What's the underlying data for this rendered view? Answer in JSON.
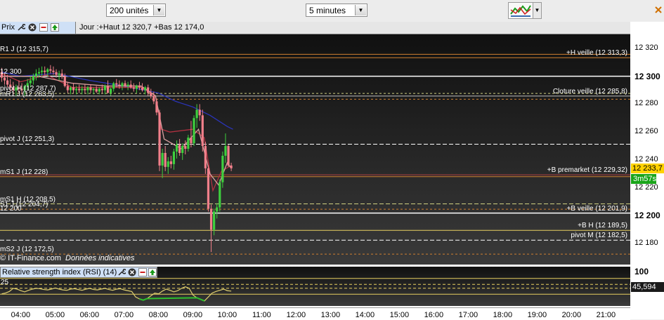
{
  "toolbar": {
    "units_select": "200 unités",
    "interval_select": "5 minutes",
    "tool_icon": "chart-tools-icon",
    "close_icon": "close-icon"
  },
  "header": {
    "prix": "Prix",
    "summary": "Jour :+Haut 12 320,7 +Bas 12 174,0",
    "icons": [
      "wrench-icon",
      "close-circle-icon",
      "minus-icon",
      "maximize-icon"
    ]
  },
  "levels": [
    {
      "name": "r1",
      "price": 12315.7,
      "color": "#d08030",
      "dash": "",
      "left_label": "R1 J (12 315,7)",
      "right_label": ""
    },
    {
      "name": "h-veille",
      "price": 12313.3,
      "color": "#d08030",
      "dash": "",
      "left_label": "",
      "right_label": "+H veille (12 313,3)"
    },
    {
      "name": "round-12300",
      "price": 12300,
      "color": "#ffffff",
      "dash": "",
      "left_label": "12 300",
      "right_label": ""
    },
    {
      "name": "pivot-h",
      "price": 12287.7,
      "color": "#d0d080",
      "dash": "3,3",
      "left_label": "pivot H (12 287,7)",
      "right_label": ""
    },
    {
      "name": "cloture-veille",
      "price": 12285.8,
      "color": "#c0c0c0",
      "dash": "",
      "left_label": "",
      "right_label": "Cloture veille (12 285,8)"
    },
    {
      "name": "mr1",
      "price": 12283.5,
      "color": "#d08030",
      "dash": "3,3",
      "left_label": "mR1 J (12 283,5)",
      "right_label": ""
    },
    {
      "name": "pivot-j",
      "price": 12251.3,
      "color": "#ffffff",
      "dash": "6,3",
      "left_label": "pivot J (12 251,3)",
      "right_label": ""
    },
    {
      "name": "ms1",
      "price": 12228,
      "color": "#d08030",
      "dash": "",
      "left_label": "mS1 J (12 228)",
      "right_label": ""
    },
    {
      "name": "premarket",
      "price": 12229.32,
      "color": "#b04040",
      "dash": "",
      "left_label": "",
      "right_label": "+B premarket (12 229,32)"
    },
    {
      "name": "ms1-h",
      "price": 12208.5,
      "color": "#d0d080",
      "dash": "6,3",
      "left_label": "mS1 H (12 208,5)",
      "right_label": ""
    },
    {
      "name": "s1",
      "price": 12204.7,
      "color": "#d08030",
      "dash": "3,3",
      "left_label": "S1 J (12 204,7)",
      "right_label": ""
    },
    {
      "name": "b-veille",
      "price": 12201.9,
      "color": "#ffffff",
      "dash": "",
      "left_label": "12 200",
      "right_label": "+B veille (12 201,9)"
    },
    {
      "name": "bh",
      "price": 12189.5,
      "color": "#e8d060",
      "dash": "",
      "left_label": "",
      "right_label": "+B H (12 189,5)"
    },
    {
      "name": "pivot-m",
      "price": 12182.5,
      "color": "#ffffff",
      "dash": "6,3",
      "left_label": "",
      "right_label": "pivot M (12 182,5)"
    },
    {
      "name": "ms2",
      "price": 12172.5,
      "color": "#d08030",
      "dash": "3,3",
      "left_label": "mS2 J (12 172,5)",
      "right_label": ""
    }
  ],
  "yaxis": {
    "ticks": [
      {
        "label": "12 320",
        "value": 12320,
        "bold": false
      },
      {
        "label": "12 300",
        "value": 12300,
        "bold": true
      },
      {
        "label": "12 280",
        "value": 12280,
        "bold": false
      },
      {
        "label": "12 260",
        "value": 12260,
        "bold": false
      },
      {
        "label": "12 240",
        "value": 12240,
        "bold": false
      },
      {
        "label": "12 220",
        "value": 12220,
        "bold": false
      },
      {
        "label": "12 200",
        "value": 12200,
        "bold": true
      },
      {
        "label": "12 180",
        "value": 12180,
        "bold": false
      }
    ],
    "current_price": "12 233,7",
    "timer": "3m57s"
  },
  "footer": {
    "copyright": "© IT-Finance.com",
    "note": "Données indicatives"
  },
  "rsi": {
    "title": "Relative strength index (RSI) (14)",
    "top_label": "100",
    "left_label": "25",
    "value": "45,594",
    "icons": [
      "wrench-icon",
      "close-circle-icon",
      "minus-icon",
      "maximize-icon"
    ]
  },
  "xaxis": {
    "labels": [
      "04:00",
      "05:00",
      "06:00",
      "07:00",
      "08:00",
      "09:00",
      "10:00",
      "11:00",
      "12:00",
      "13:00",
      "14:00",
      "15:00",
      "16:00",
      "17:00",
      "18:00",
      "19:00",
      "20:00",
      "21:00"
    ]
  },
  "chart_data": {
    "type": "candlestick",
    "ylim": [
      12165,
      12330
    ],
    "xlim": [
      "03:24",
      "21:30"
    ],
    "candles": [
      {
        "t": "03:27",
        "o": 12303,
        "h": 12306,
        "l": 12296,
        "c": 12299
      },
      {
        "t": "03:32",
        "o": 12299,
        "h": 12302,
        "l": 12294,
        "c": 12297
      },
      {
        "t": "03:37",
        "o": 12297,
        "h": 12301,
        "l": 12292,
        "c": 12294
      },
      {
        "t": "03:42",
        "o": 12294,
        "h": 12298,
        "l": 12289,
        "c": 12292
      },
      {
        "t": "03:47",
        "o": 12292,
        "h": 12296,
        "l": 12287,
        "c": 12290
      },
      {
        "t": "03:52",
        "o": 12290,
        "h": 12294,
        "l": 12286,
        "c": 12292
      },
      {
        "t": "03:57",
        "o": 12292,
        "h": 12297,
        "l": 12288,
        "c": 12291
      },
      {
        "t": "04:02",
        "o": 12291,
        "h": 12295,
        "l": 12287,
        "c": 12290
      },
      {
        "t": "04:07",
        "o": 12290,
        "h": 12294,
        "l": 12286,
        "c": 12293
      },
      {
        "t": "04:12",
        "o": 12293,
        "h": 12298,
        "l": 12290,
        "c": 12295
      },
      {
        "t": "04:17",
        "o": 12295,
        "h": 12300,
        "l": 12292,
        "c": 12297
      },
      {
        "t": "04:22",
        "o": 12297,
        "h": 12302,
        "l": 12294,
        "c": 12300
      },
      {
        "t": "04:27",
        "o": 12300,
        "h": 12305,
        "l": 12297,
        "c": 12302
      },
      {
        "t": "04:32",
        "o": 12302,
        "h": 12306,
        "l": 12299,
        "c": 12303
      },
      {
        "t": "04:37",
        "o": 12303,
        "h": 12307,
        "l": 12300,
        "c": 12304
      },
      {
        "t": "04:42",
        "o": 12304,
        "h": 12307,
        "l": 12301,
        "c": 12303
      },
      {
        "t": "04:47",
        "o": 12303,
        "h": 12306,
        "l": 12300,
        "c": 12305
      },
      {
        "t": "04:52",
        "o": 12305,
        "h": 12308,
        "l": 12302,
        "c": 12304
      },
      {
        "t": "04:57",
        "o": 12304,
        "h": 12307,
        "l": 12301,
        "c": 12303
      },
      {
        "t": "05:02",
        "o": 12303,
        "h": 12305,
        "l": 12299,
        "c": 12301
      },
      {
        "t": "05:07",
        "o": 12301,
        "h": 12304,
        "l": 12297,
        "c": 12302
      },
      {
        "t": "05:12",
        "o": 12302,
        "h": 12305,
        "l": 12298,
        "c": 12300
      },
      {
        "t": "05:17",
        "o": 12300,
        "h": 12302,
        "l": 12292,
        "c": 12293
      },
      {
        "t": "05:22",
        "o": 12293,
        "h": 12296,
        "l": 12288,
        "c": 12290
      },
      {
        "t": "05:27",
        "o": 12290,
        "h": 12293,
        "l": 12287,
        "c": 12292
      },
      {
        "t": "05:32",
        "o": 12292,
        "h": 12295,
        "l": 12288,
        "c": 12290
      },
      {
        "t": "05:37",
        "o": 12290,
        "h": 12293,
        "l": 12287,
        "c": 12291
      },
      {
        "t": "05:42",
        "o": 12291,
        "h": 12294,
        "l": 12288,
        "c": 12290
      },
      {
        "t": "05:47",
        "o": 12290,
        "h": 12293,
        "l": 12287,
        "c": 12291
      },
      {
        "t": "05:52",
        "o": 12291,
        "h": 12294,
        "l": 12288,
        "c": 12290
      },
      {
        "t": "05:57",
        "o": 12290,
        "h": 12293,
        "l": 12287,
        "c": 12292
      },
      {
        "t": "06:02",
        "o": 12292,
        "h": 12294,
        "l": 12288,
        "c": 12290
      },
      {
        "t": "06:07",
        "o": 12290,
        "h": 12292,
        "l": 12287,
        "c": 12291
      },
      {
        "t": "06:12",
        "o": 12291,
        "h": 12293,
        "l": 12288,
        "c": 12289
      },
      {
        "t": "06:17",
        "o": 12289,
        "h": 12292,
        "l": 12287,
        "c": 12291
      },
      {
        "t": "06:22",
        "o": 12291,
        "h": 12294,
        "l": 12288,
        "c": 12290
      },
      {
        "t": "06:27",
        "o": 12290,
        "h": 12294,
        "l": 12287,
        "c": 12293
      },
      {
        "t": "06:32",
        "o": 12293,
        "h": 12297,
        "l": 12289,
        "c": 12288
      },
      {
        "t": "06:37",
        "o": 12288,
        "h": 12292,
        "l": 12286,
        "c": 12291
      },
      {
        "t": "06:42",
        "o": 12291,
        "h": 12296,
        "l": 12289,
        "c": 12295
      },
      {
        "t": "06:47",
        "o": 12295,
        "h": 12298,
        "l": 12292,
        "c": 12294
      },
      {
        "t": "06:52",
        "o": 12294,
        "h": 12297,
        "l": 12291,
        "c": 12293
      },
      {
        "t": "06:57",
        "o": 12293,
        "h": 12296,
        "l": 12290,
        "c": 12295
      },
      {
        "t": "07:02",
        "o": 12295,
        "h": 12297,
        "l": 12292,
        "c": 12293
      },
      {
        "t": "07:07",
        "o": 12293,
        "h": 12296,
        "l": 12290,
        "c": 12294
      },
      {
        "t": "07:12",
        "o": 12294,
        "h": 12297,
        "l": 12291,
        "c": 12292
      },
      {
        "t": "07:17",
        "o": 12292,
        "h": 12295,
        "l": 12289,
        "c": 12291
      },
      {
        "t": "07:22",
        "o": 12291,
        "h": 12294,
        "l": 12288,
        "c": 12293
      },
      {
        "t": "07:27",
        "o": 12293,
        "h": 12296,
        "l": 12290,
        "c": 12292
      },
      {
        "t": "07:32",
        "o": 12292,
        "h": 12295,
        "l": 12289,
        "c": 12290
      },
      {
        "t": "07:37",
        "o": 12290,
        "h": 12293,
        "l": 12287,
        "c": 12292
      },
      {
        "t": "07:42",
        "o": 12292,
        "h": 12294,
        "l": 12286,
        "c": 12288
      },
      {
        "t": "07:47",
        "o": 12288,
        "h": 12291,
        "l": 12284,
        "c": 12286
      },
      {
        "t": "07:52",
        "o": 12286,
        "h": 12289,
        "l": 12280,
        "c": 12282
      },
      {
        "t": "07:57",
        "o": 12282,
        "h": 12284,
        "l": 12272,
        "c": 12274
      },
      {
        "t": "08:02",
        "o": 12274,
        "h": 12276,
        "l": 12232,
        "c": 12236
      },
      {
        "t": "08:07",
        "o": 12236,
        "h": 12248,
        "l": 12227,
        "c": 12245
      },
      {
        "t": "08:12",
        "o": 12245,
        "h": 12250,
        "l": 12232,
        "c": 12235
      },
      {
        "t": "08:17",
        "o": 12235,
        "h": 12242,
        "l": 12230,
        "c": 12239
      },
      {
        "t": "08:22",
        "o": 12239,
        "h": 12243,
        "l": 12234,
        "c": 12237
      },
      {
        "t": "08:27",
        "o": 12237,
        "h": 12248,
        "l": 12233,
        "c": 12246
      },
      {
        "t": "08:32",
        "o": 12246,
        "h": 12254,
        "l": 12241,
        "c": 12251
      },
      {
        "t": "08:37",
        "o": 12251,
        "h": 12255,
        "l": 12243,
        "c": 12245
      },
      {
        "t": "08:42",
        "o": 12245,
        "h": 12252,
        "l": 12240,
        "c": 12250
      },
      {
        "t": "08:47",
        "o": 12250,
        "h": 12254,
        "l": 12244,
        "c": 12248
      },
      {
        "t": "08:52",
        "o": 12248,
        "h": 12258,
        "l": 12246,
        "c": 12256
      },
      {
        "t": "08:57",
        "o": 12256,
        "h": 12268,
        "l": 12249,
        "c": 12252
      },
      {
        "t": "09:02",
        "o": 12252,
        "h": 12272,
        "l": 12250,
        "c": 12270
      },
      {
        "t": "09:07",
        "o": 12270,
        "h": 12280,
        "l": 12263,
        "c": 12276
      },
      {
        "t": "09:12",
        "o": 12276,
        "h": 12280,
        "l": 12268,
        "c": 12272
      },
      {
        "t": "09:17",
        "o": 12272,
        "h": 12276,
        "l": 12246,
        "c": 12250
      },
      {
        "t": "09:22",
        "o": 12250,
        "h": 12253,
        "l": 12230,
        "c": 12234
      },
      {
        "t": "09:27",
        "o": 12234,
        "h": 12236,
        "l": 12203,
        "c": 12205
      },
      {
        "t": "09:32",
        "o": 12205,
        "h": 12208,
        "l": 12174,
        "c": 12190
      },
      {
        "t": "09:37",
        "o": 12190,
        "h": 12205,
        "l": 12186,
        "c": 12203
      },
      {
        "t": "09:42",
        "o": 12203,
        "h": 12209,
        "l": 12198,
        "c": 12206
      },
      {
        "t": "09:47",
        "o": 12206,
        "h": 12226,
        "l": 12203,
        "c": 12224
      },
      {
        "t": "09:52",
        "o": 12224,
        "h": 12246,
        "l": 12220,
        "c": 12243
      },
      {
        "t": "09:57",
        "o": 12243,
        "h": 12259,
        "l": 12238,
        "c": 12250
      },
      {
        "t": "10:02",
        "o": 12250,
        "h": 12251,
        "l": 12235,
        "c": 12236
      },
      {
        "t": "10:07",
        "o": 12236,
        "h": 12238,
        "l": 12232,
        "c": 12234
      }
    ],
    "moving_averages": [
      {
        "name": "",
        "color": "#2b34b8",
        "points": [
          [
            "03:27",
            12303
          ],
          [
            "04:00",
            12300
          ],
          [
            "05:00",
            12302
          ],
          [
            "06:00",
            12297
          ],
          [
            "07:00",
            12293
          ],
          [
            "08:00",
            12288
          ],
          [
            "08:30",
            12282
          ],
          [
            "09:00",
            12278
          ],
          [
            "09:30",
            12272
          ],
          [
            "10:00",
            12264
          ],
          [
            "10:10",
            12262
          ]
        ]
      },
      {
        "name": "",
        "color": "#b03040",
        "points": [
          [
            "03:27",
            12302
          ],
          [
            "04:00",
            12296
          ],
          [
            "04:45",
            12301
          ],
          [
            "05:30",
            12292
          ],
          [
            "06:30",
            12292
          ],
          [
            "07:30",
            12292
          ],
          [
            "07:55",
            12286
          ],
          [
            "08:05",
            12262
          ],
          [
            "08:20",
            12260
          ],
          [
            "09:00",
            12262
          ],
          [
            "09:20",
            12256
          ],
          [
            "09:35",
            12218
          ],
          [
            "09:50",
            12232
          ],
          [
            "10:07",
            12236
          ]
        ]
      },
      {
        "name": "",
        "color": "#d8a0a0",
        "points": [
          [
            "03:27",
            12300
          ],
          [
            "04:30",
            12300
          ],
          [
            "05:30",
            12295
          ],
          [
            "06:30",
            12293
          ],
          [
            "07:30",
            12293
          ],
          [
            "07:55",
            12286
          ],
          [
            "08:10",
            12255
          ],
          [
            "08:40",
            12248
          ],
          [
            "09:10",
            12262
          ],
          [
            "09:30",
            12230
          ],
          [
            "09:45",
            12222
          ],
          [
            "10:00",
            12238
          ],
          [
            "10:07",
            12234
          ]
        ]
      }
    ],
    "rsi_series": [
      38,
      40,
      44,
      52,
      50,
      46,
      43,
      47,
      50,
      52,
      51,
      49,
      48,
      50,
      53,
      50,
      48,
      47,
      50,
      51,
      49,
      47,
      50,
      52,
      49,
      48,
      50,
      52,
      49,
      47,
      50,
      51,
      48,
      46,
      44,
      30,
      25,
      22,
      26,
      33,
      40,
      38,
      45,
      50,
      47,
      43,
      46,
      52,
      56,
      52,
      35,
      28,
      24,
      20,
      30,
      40,
      44,
      47,
      50,
      46,
      45
    ]
  }
}
